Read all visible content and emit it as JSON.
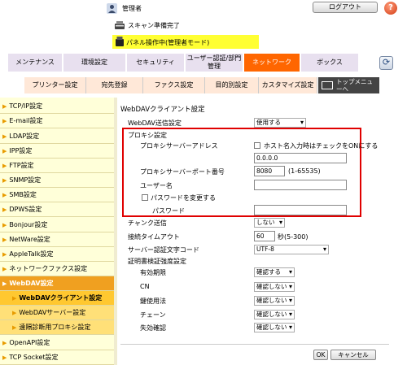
{
  "header": {
    "user_label": "管理者",
    "logout_label": "ログアウト",
    "help_label": "?",
    "scan_status": "スキャン準備完了",
    "panel_status": "パネル操作中(管理者モード)"
  },
  "tabs_main": [
    "メンテナンス",
    "環境設定",
    "セキュリティ",
    "ユーザー認証/部門管理",
    "ネットワーク",
    "ボックス"
  ],
  "tabs_sub": [
    "プリンター設定",
    "宛先登録",
    "ファクス設定",
    "目的別設定",
    "カスタマイズ設定",
    "トップメニューへ"
  ],
  "sidebar": {
    "items": [
      "TCP/IP設定",
      "E-mail設定",
      "LDAP設定",
      "IPP設定",
      "FTP設定",
      "SNMP設定",
      "SMB設定",
      "DPWS設定",
      "Bonjour設定",
      "NetWare設定",
      "AppleTalk設定",
      "ネットワークファクス設定",
      "WebDAV設定",
      "WebDAVクライアント設定",
      "WebDAVサーバー設定",
      "遠隔診断用プロキシ設定",
      "OpenAPI設定",
      "TCP Socket設定"
    ]
  },
  "content": {
    "title": "WebDAVクライアント設定",
    "send_label": "WebDAV送信設定",
    "send_value": "使用する",
    "proxy_header": "プロキシ設定",
    "proxy_addr_label": "プロキシサーバーアドレス",
    "hostname_check_label": "ホスト名入力時はチェックをONにする",
    "proxy_addr_value": "0.0.0.0",
    "proxy_port_label": "プロキシサーバーポート番号",
    "proxy_port_value": "8080",
    "proxy_port_range": "(1-65535)",
    "username_label": "ユーザー名",
    "username_value": "",
    "change_password_label": "パスワードを変更する",
    "password_label": "パスワード",
    "password_value": "",
    "chunk_label": "チャンク送信",
    "chunk_value": "しない",
    "timeout_label": "接続タイムアウト",
    "timeout_value": "60",
    "timeout_unit": "秒(5-300)",
    "charset_label": "サーバー認証文字コード",
    "charset_value": "UTF-8",
    "cert_header": "証明書検証強度設定",
    "validity_label": "有効期限",
    "validity_value": "確認する",
    "cn_label": "CN",
    "cn_value": "確認しない",
    "key_usage_label": "鍵使用法",
    "key_usage_value": "確認しない",
    "chain_label": "チェーン",
    "chain_value": "確認しない",
    "expired_label": "失効確認",
    "expired_value": "確認しない",
    "ok_label": "OK",
    "cancel_label": "キャンセル"
  },
  "colors": {
    "tab_active": "#ff6600",
    "sidebar_bg": "#ffffd9",
    "sidebar_active": "#f0a020",
    "highlight_red": "#e00000",
    "panel_bar": "#ffff33"
  }
}
